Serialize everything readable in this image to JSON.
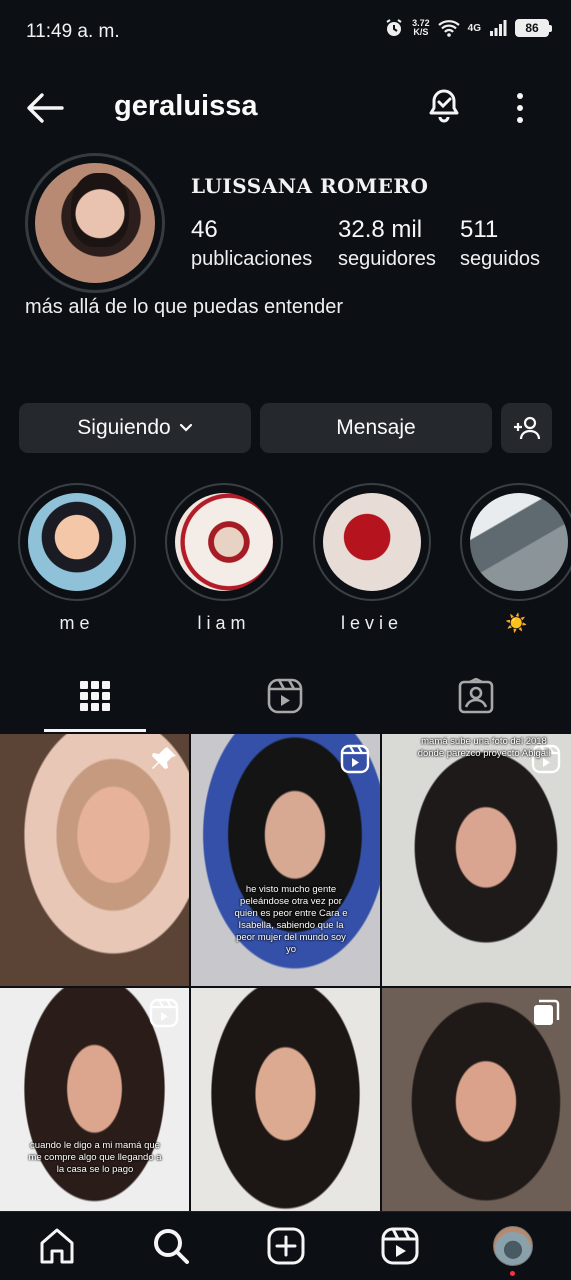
{
  "status_bar": {
    "time": "11:49 a. m.",
    "speed_value": "3.72",
    "speed_unit": "K/S",
    "network": "4G",
    "battery": "86"
  },
  "header": {
    "username": "geraluissa",
    "icons": [
      "back-arrow-icon",
      "notification-bell-icon",
      "more-options-icon"
    ]
  },
  "profile": {
    "display_name": "LUISSANA ROMERO",
    "stats": [
      {
        "value": "46",
        "label": "publicaciones"
      },
      {
        "value": "32.8 mil",
        "label": "seguidores"
      },
      {
        "value": "511",
        "label": "seguidos"
      }
    ],
    "bio": "más allá de lo que puedas entender"
  },
  "actions": {
    "following_label": "Siguiendo",
    "message_label": "Mensaje"
  },
  "highlights": [
    {
      "label": "me"
    },
    {
      "label": "liam"
    },
    {
      "label": "levie"
    },
    {
      "label": "☀️"
    }
  ],
  "tabs": [
    "grid-icon",
    "reels-icon",
    "tagged-icon"
  ],
  "posts": [
    {
      "badge": "pin-icon",
      "text": ""
    },
    {
      "badge": "reel-icon",
      "text": "he visto mucho gente peleándose otra vez por quien es peor entre Cara e Isabella, sabiendo que la peor mujer del mundo soy yo"
    },
    {
      "badge": "reel-icon",
      "text": "mamá sube una foto del 2018 donde parezco proyecto Abigail"
    },
    {
      "badge": "reel-icon",
      "text": "cuando le digo a mi mamá que me compre algo que llegando a la casa se lo pago"
    },
    {
      "badge": "",
      "text": ""
    },
    {
      "badge": "carousel-icon",
      "text": ""
    }
  ],
  "colors": {
    "background": "#0c1014",
    "button": "#25292e",
    "text": "#f5f5f5",
    "notification_dot": "#ff3040"
  }
}
